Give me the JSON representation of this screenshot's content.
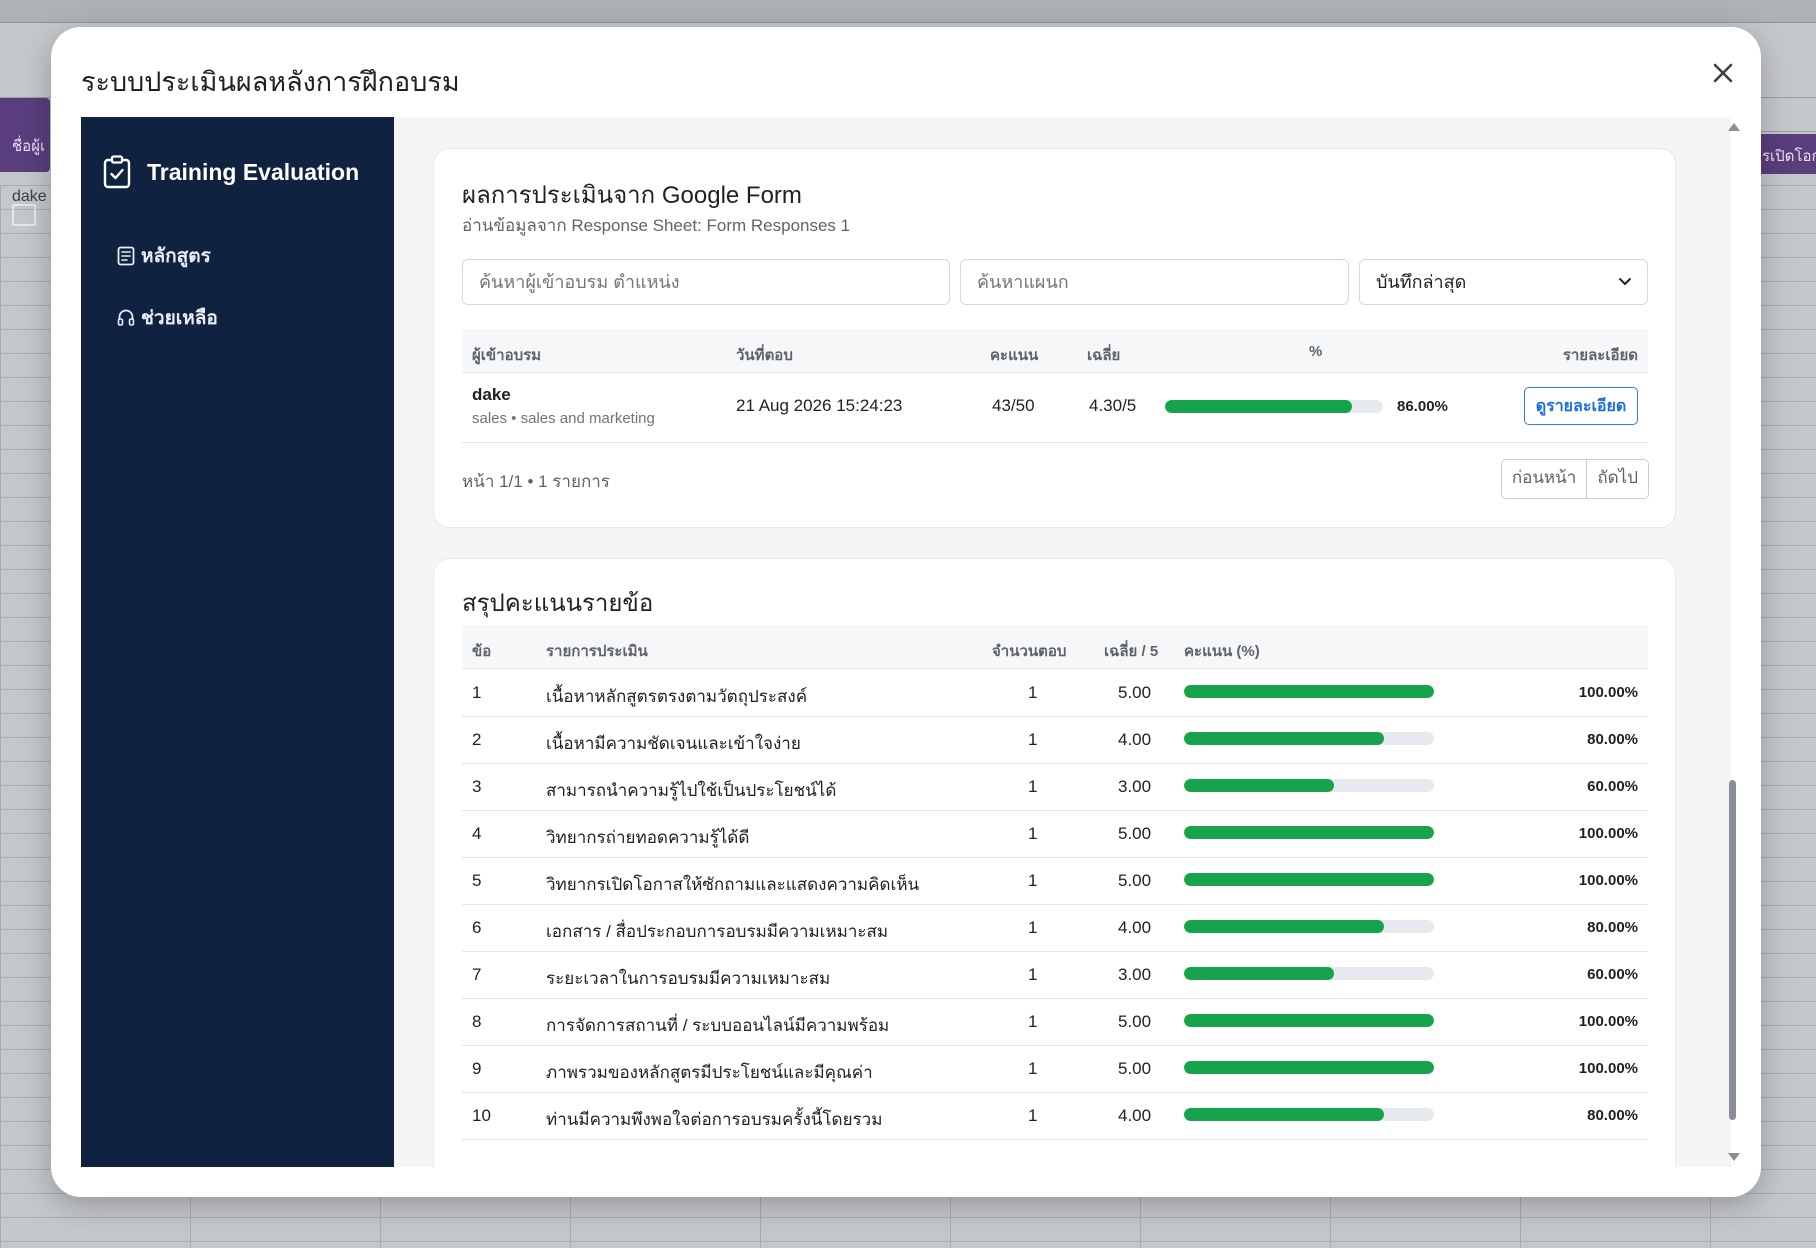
{
  "background": {
    "sheet_cell_name": "dake",
    "left_tab_label": "ชื่อผู้เ",
    "right_tab_label": "รเปิดโอก"
  },
  "modal": {
    "title": "ระบบประเมินผลหลังการฝึกอบรม",
    "close_icon": "close-icon"
  },
  "sidebar": {
    "brand": "Training Evaluation",
    "brand_icon": "clipboard-check-icon",
    "items": [
      {
        "label": "หลักสูตร",
        "icon": "list-document-icon"
      },
      {
        "label": "ช่วยเหลือ",
        "icon": "headset-icon"
      }
    ]
  },
  "results": {
    "title": "ผลการประเมินจาก Google Form",
    "subtitle": "อ่านข้อมูลจาก Response Sheet: Form Responses 1",
    "search_placeholder": "ค้นหาผู้เข้าอบรม ตำแหน่ง",
    "department_placeholder": "ค้นหาแผนก",
    "sort_selected": "บันทึกล่าสุด",
    "headers": {
      "participant": "ผู้เข้าอบรม",
      "date": "วันที่ตอบ",
      "score": "คะแนน",
      "avg": "เฉลี่ย",
      "percent": "%",
      "detail": "รายละเอียด"
    },
    "rows": [
      {
        "name": "dake",
        "meta": "sales • sales and marketing",
        "date": "21 Aug 2026 15:24:23",
        "score": "43/50",
        "avg": "4.30/5",
        "percent_value": 86.0,
        "percent": "86.00%",
        "detail_label": "ดูรายละเอียด"
      }
    ],
    "pager_text": "หน้า 1/1 • 1 รายการ",
    "prev_label": "ก่อนหน้า",
    "next_label": "ถัดไป"
  },
  "summary": {
    "title": "สรุปคะแนนรายข้อ",
    "headers": {
      "no": "ข้อ",
      "item": "รายการประเมิน",
      "count": "จำนวนตอบ",
      "avg": "เฉลี่ย / 5",
      "score": "คะแนน (%)"
    },
    "rows": [
      {
        "no": "1",
        "item": "เนื้อหาหลักสูตรตรงตามวัตถุประสงค์",
        "count": "1",
        "avg": "5.00",
        "pct_value": 100,
        "pct": "100.00%"
      },
      {
        "no": "2",
        "item": "เนื้อหามีความชัดเจนและเข้าใจง่าย",
        "count": "1",
        "avg": "4.00",
        "pct_value": 80,
        "pct": "80.00%"
      },
      {
        "no": "3",
        "item": "สามารถนำความรู้ไปใช้เป็นประโยชน์ได้",
        "count": "1",
        "avg": "3.00",
        "pct_value": 60,
        "pct": "60.00%"
      },
      {
        "no": "4",
        "item": "วิทยากรถ่ายทอดความรู้ได้ดี",
        "count": "1",
        "avg": "5.00",
        "pct_value": 100,
        "pct": "100.00%"
      },
      {
        "no": "5",
        "item": "วิทยากรเปิดโอกาสให้ซักถามและแสดงความคิดเห็น",
        "count": "1",
        "avg": "5.00",
        "pct_value": 100,
        "pct": "100.00%"
      },
      {
        "no": "6",
        "item": "เอกสาร / สื่อประกอบการอบรมมีความเหมาะสม",
        "count": "1",
        "avg": "4.00",
        "pct_value": 80,
        "pct": "80.00%"
      },
      {
        "no": "7",
        "item": "ระยะเวลาในการอบรมมีความเหมาะสม",
        "count": "1",
        "avg": "3.00",
        "pct_value": 60,
        "pct": "60.00%"
      },
      {
        "no": "8",
        "item": "การจัดการสถานที่ / ระบบออนไลน์มีความพร้อม",
        "count": "1",
        "avg": "5.00",
        "pct_value": 100,
        "pct": "100.00%"
      },
      {
        "no": "9",
        "item": "ภาพรวมของหลักสูตรมีประโยชน์และมีคุณค่า",
        "count": "1",
        "avg": "5.00",
        "pct_value": 100,
        "pct": "100.00%"
      },
      {
        "no": "10",
        "item": "ท่านมีความพึงพอใจต่อการอบรมครั้งนี้โดยรวม",
        "count": "1",
        "avg": "4.00",
        "pct_value": 80,
        "pct": "80.00%"
      }
    ]
  },
  "colors": {
    "sidebar_bg": "#0f2341",
    "bar_fill": "#16a34a",
    "bar_track": "#e6eaef",
    "accent_blue": "#1a6fe0"
  }
}
